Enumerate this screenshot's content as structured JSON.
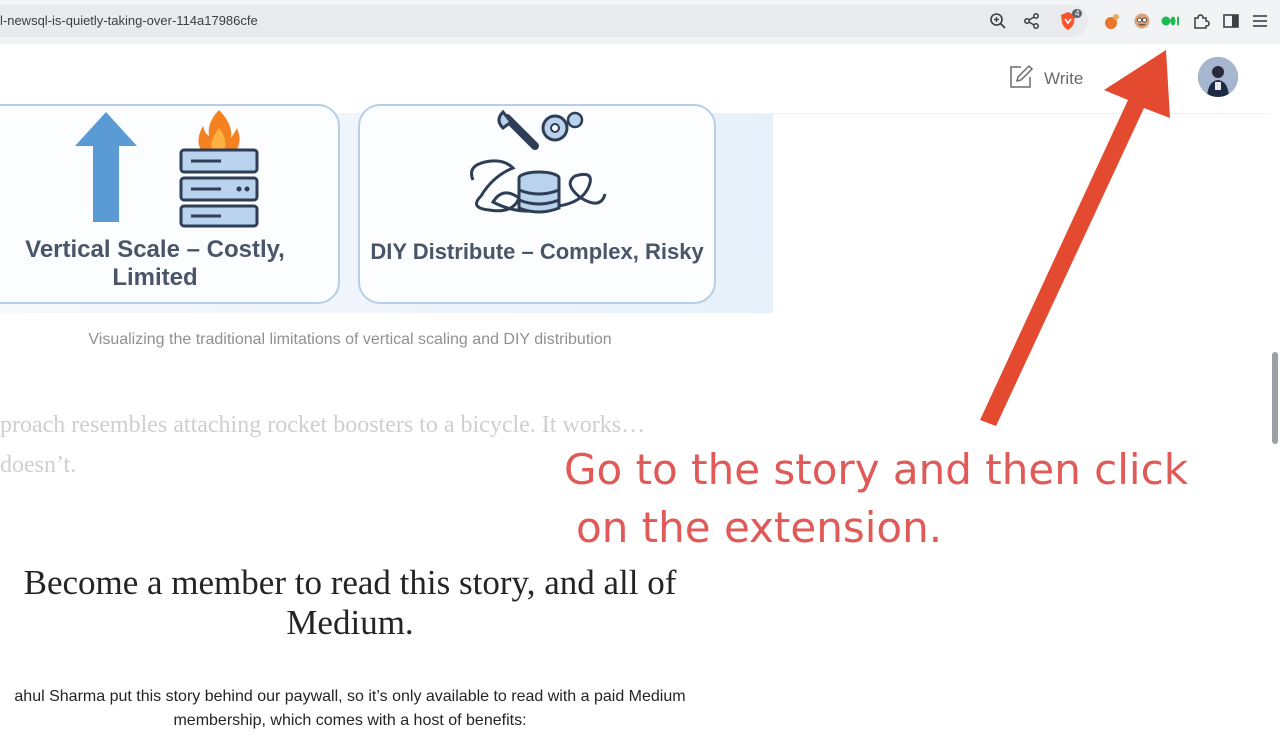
{
  "browser": {
    "url": "l-newsql-is-quietly-taking-over-114a17986cfe",
    "icons": [
      "zoom-icon",
      "share-icon",
      "brave-shield-icon",
      "extension-orange-icon",
      "extension-face-icon",
      "extension-green-icon",
      "extensions-puzzle-icon",
      "sidebar-icon",
      "menu-icon"
    ],
    "shield_badge": "4"
  },
  "header": {
    "write_label": "Write",
    "write_icon": "pencil-square-icon",
    "avatar": "user-avatar"
  },
  "illustration": {
    "card1_title_line1": "Vertical Scale – Costly,",
    "card1_title_line2": "Limited",
    "card2_title": "DIY Distribute – Complex, Risky",
    "caption": "Visualizing the traditional limitations of vertical scaling and DIY distribution"
  },
  "article": {
    "faded_line1": "proach resembles attaching rocket boosters to a bicycle. It works…",
    "faded_line2": "doesn’t."
  },
  "annotation": {
    "line1": "Go to the story and then click",
    "line2": "on the extension.",
    "color": "#e05a57",
    "arrow_color": "#e34a2f"
  },
  "paywall": {
    "title_line1": "Become a member to read this story, and all of",
    "title_line2": "Medium.",
    "text_line1": "ahul Sharma put this story behind our paywall, so it’s only available to read with a paid Medium",
    "text_line2": "membership, which comes with a host of benefits:"
  }
}
